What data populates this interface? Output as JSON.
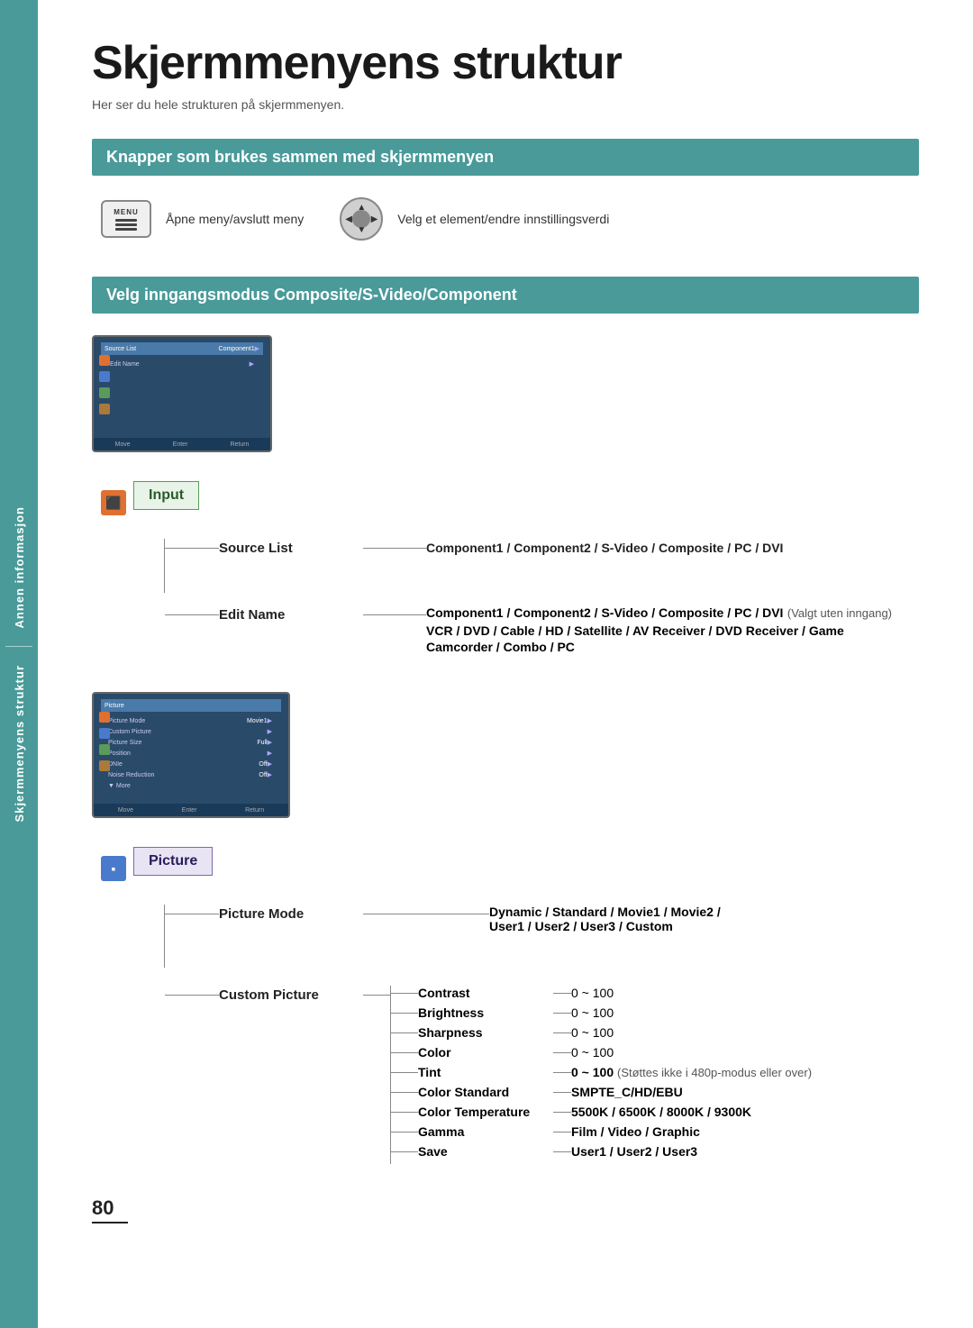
{
  "sidebar": {
    "text1": "Annen informasjon",
    "text2": "Skjermmenyens struktur"
  },
  "page": {
    "title": "Skjermmenyens struktur",
    "subtitle": "Her ser du hele strukturen på skjermmenyen.",
    "page_number": "80"
  },
  "section1": {
    "header": "Knapper som brukes sammen med skjermmenyen",
    "menu_label": "MENU",
    "menu_desc": "Åpne meny/avslutt meny",
    "nav_desc": "Velg et element/endre innstillingsverdi"
  },
  "section2": {
    "header": "Velg inngangsmodus Composite/S-Video/Component",
    "input_label": "Input",
    "source_list_label": "Source List",
    "source_list_value": "Component1 / Component2 / S-Video / Composite / PC / DVI",
    "edit_name_label": "Edit Name",
    "edit_name_value1": "Component1 / Component2 / S-Video / Composite / PC / DVI",
    "edit_name_note": "(Valgt uten inngang)",
    "edit_name_value2": "VCR / DVD / Cable / HD / Satellite / AV Receiver / DVD Receiver / Game",
    "edit_name_value3": "Camcorder / Combo / PC"
  },
  "section3": {
    "picture_label": "Picture",
    "picture_mode_label": "Picture Mode",
    "picture_mode_value": "Dynamic / Standard / Movie1 / Movie2 /",
    "picture_mode_value2": "User1 / User2 / User3 / Custom",
    "custom_picture_label": "Custom Picture",
    "items": [
      {
        "label": "Contrast",
        "value": "0 ~ 100"
      },
      {
        "label": "Brightness",
        "value": "0 ~ 100"
      },
      {
        "label": "Sharpness",
        "value": "0 ~ 100"
      },
      {
        "label": "Color",
        "value": "0 ~ 100"
      },
      {
        "label": "Tint",
        "value": "0 ~ 100",
        "note": "(Støttes ikke i 480p-modus eller over)"
      },
      {
        "label": "Color Standard",
        "value": "SMPTE_C/HD/EBU"
      },
      {
        "label": "Color Temperature",
        "value": "5500K / 6500K / 8000K / 9300K"
      },
      {
        "label": "Gamma",
        "value": "Film / Video / Graphic"
      },
      {
        "label": "Save",
        "value": "User1 / User2 / User3"
      }
    ]
  }
}
